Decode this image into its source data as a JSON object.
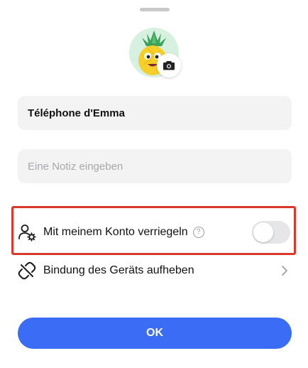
{
  "device_name": "Téléphone d'Emma",
  "note": {
    "value": "",
    "placeholder": "Eine Notiz eingeben"
  },
  "lock_row": {
    "label": "Mit meinem Konto verriegeln",
    "help_icon": "?",
    "toggle_on": false
  },
  "unbind_row": {
    "label": "Bindung des Geräts aufheben"
  },
  "ok_button": {
    "label": "OK"
  },
  "colors": {
    "accent": "#3b6cf6",
    "highlight": "#d8392b",
    "field_bg": "#f3f3f4",
    "avatar_bg": "#d6f1df"
  },
  "icons": {
    "avatar": "pineapple-avatar",
    "camera": "camera-icon",
    "lock": "user-gear-icon",
    "unbind": "broken-link-icon",
    "chevron": "chevron-right-icon"
  }
}
